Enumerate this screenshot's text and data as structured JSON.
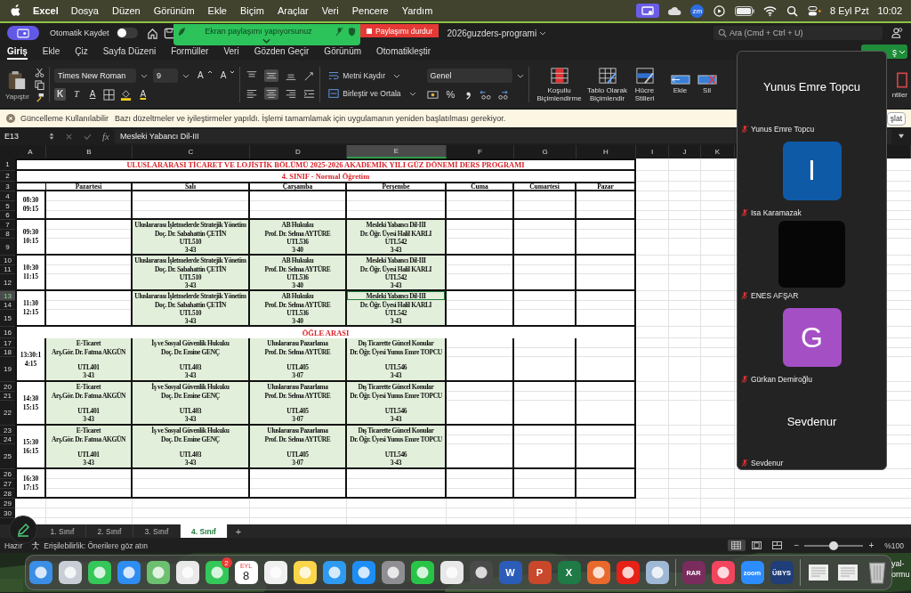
{
  "menu_bar": {
    "app": "Excel",
    "items": [
      "Dosya",
      "Düzen",
      "Görünüm",
      "Ekle",
      "Biçim",
      "Araçlar",
      "Veri",
      "Pencere",
      "Yardım"
    ],
    "zoom_badge": "zm",
    "date": "8 Eyl Pzt",
    "time": "10:02"
  },
  "title_bar": {
    "autosave_label": "Otomatik Kaydet",
    "autosave_on": false,
    "filename": "2026guzders-programi",
    "search_placeholder": "Ara (Cmd + Ctrl + U)"
  },
  "share_banner": {
    "text": "Ekran paylaşımı yapıyorsunuz",
    "stop_button": "Paylaşımı durdur"
  },
  "ribbon_tabs": [
    {
      "label": "Giriş",
      "selected": true
    },
    {
      "label": "Ekle",
      "selected": false
    },
    {
      "label": "Çiz",
      "selected": false
    },
    {
      "label": "Sayfa Düzeni",
      "selected": false
    },
    {
      "label": "Formüller",
      "selected": false
    },
    {
      "label": "Veri",
      "selected": false
    },
    {
      "label": "Gözden Geçir",
      "selected": false
    },
    {
      "label": "Görünüm",
      "selected": false
    },
    {
      "label": "Otomatikleştir",
      "selected": false
    }
  ],
  "share_button": "ş",
  "ribbon": {
    "paste": "Yapıştır",
    "font": "Times New Roman",
    "size": "9",
    "grow": "A",
    "shrink": "A",
    "styles": [
      {
        "label": "K",
        "kind": "bold",
        "selected": true
      },
      {
        "label": "T",
        "kind": "italic",
        "selected": false
      },
      {
        "label": "A",
        "kind": "underline",
        "selected": false
      }
    ],
    "font_color": "A",
    "align_vertical": [
      {
        "kind": "top",
        "selected": false
      },
      {
        "kind": "middle",
        "selected": true
      },
      {
        "kind": "bottom",
        "selected": false
      }
    ],
    "align_horizontal": [
      {
        "kind": "left",
        "selected": false
      },
      {
        "kind": "center",
        "selected": true
      },
      {
        "kind": "right",
        "selected": false
      }
    ],
    "wrap": "Metni Kaydır",
    "merge": "Birleştir ve Ortala",
    "number_format": "Genel",
    "percent": "%",
    "big_buttons": [
      {
        "label": "Koşullu Biçimlendirme",
        "kind": "conditional"
      },
      {
        "label": "Tablo Olarak Biçimlendir",
        "kind": "table"
      },
      {
        "label": "Hücre Stilleri",
        "kind": "styles"
      },
      {
        "label": "Ekle",
        "kind": "insert"
      },
      {
        "label": "Sil",
        "kind": "delete"
      }
    ],
    "cut_button": "ntiler"
  },
  "notification": {
    "title": "Güncelleme Kullanılabilir",
    "message": "Bazı düzeltmeler ve iyileştirmeler yapıldı. İşlemi tamamlamak için uygulamanın yeniden başlatılması gerekiyor.",
    "button": "şlat"
  },
  "formula_bar": {
    "cell": "E13",
    "fx": "fx",
    "value": "Mesleki Yabancı Dil-III"
  },
  "columns": [
    {
      "label": "A",
      "selected": false
    },
    {
      "label": "B",
      "selected": false
    },
    {
      "label": "C",
      "selected": false
    },
    {
      "label": "D",
      "selected": false
    },
    {
      "label": "E",
      "selected": true
    },
    {
      "label": "F",
      "selected": false
    },
    {
      "label": "G",
      "selected": false
    },
    {
      "label": "H",
      "selected": false
    },
    {
      "label": "I",
      "selected": false
    },
    {
      "label": "J",
      "selected": false
    },
    {
      "label": "K",
      "selected": false
    }
  ],
  "rows": [
    {
      "label": "1",
      "selected": false
    },
    {
      "label": "2",
      "selected": false
    },
    {
      "label": "3",
      "selected": false
    },
    {
      "label": "4",
      "selected": false
    },
    {
      "label": "5",
      "selected": false
    },
    {
      "label": "6",
      "selected": false
    },
    {
      "label": "7",
      "selected": false
    },
    {
      "label": "8",
      "selected": false
    },
    {
      "label": "9",
      "selected": false
    },
    {
      "label": "10",
      "selected": false
    },
    {
      "label": "11",
      "selected": false
    },
    {
      "label": "12",
      "selected": false
    },
    {
      "label": "13",
      "selected": true
    },
    {
      "label": "14",
      "selected": false
    },
    {
      "label": "15",
      "selected": false
    },
    {
      "label": "16",
      "selected": false
    },
    {
      "label": "17",
      "selected": false
    },
    {
      "label": "18",
      "selected": false
    },
    {
      "label": "19",
      "selected": false
    },
    {
      "label": "20",
      "selected": false
    },
    {
      "label": "21",
      "selected": false
    },
    {
      "label": "22",
      "selected": false
    },
    {
      "label": "23",
      "selected": false
    },
    {
      "label": "24",
      "selected": false
    },
    {
      "label": "25",
      "selected": false
    },
    {
      "label": "26",
      "selected": false
    },
    {
      "label": "27",
      "selected": false
    },
    {
      "label": "28",
      "selected": false
    },
    {
      "label": "29",
      "selected": false
    },
    {
      "label": "30",
      "selected": false
    }
  ],
  "schedule": {
    "title": "ULUSLARARASI TİCARET VE LOJİSTİK BÖLÜMÜ 2025-2026 AKADEMİK YILI GÜZ DÖNEMİ DERS PROGRAMI",
    "subtitle": "4. SINIF - Normal Öğretim",
    "days": [
      "Pazartesi",
      "Salı",
      "Çarşamba",
      "Perşembe",
      "Cuma",
      "Cumartesi",
      "Pazar"
    ],
    "slots": [
      {
        "kind": "slot",
        "time": [
          "08:30",
          "09:15"
        ],
        "cells": [
          {
            "kind": "empty",
            "selected": false
          },
          {
            "kind": "empty",
            "selected": false
          },
          {
            "kind": "empty",
            "selected": false
          },
          {
            "kind": "empty",
            "selected": false
          },
          {
            "kind": "empty",
            "selected": false
          },
          {
            "kind": "empty",
            "selected": false
          },
          {
            "kind": "empty",
            "selected": false
          }
        ]
      },
      {
        "kind": "slot",
        "time": [
          "09:30",
          "10:15"
        ],
        "cells": [
          {
            "kind": "empty",
            "selected": false
          },
          {
            "kind": "course",
            "name": "Uluslararası İşletmelerde Stratejik Yönetim",
            "teacher": "Doç. Dr. Sabahattin ÇETİN",
            "code": "UTL510",
            "room": "3-43",
            "selected": false
          },
          {
            "kind": "course",
            "name": "AB Hukuku",
            "teacher": "Prof. Dr. Selma AYTÜRE",
            "code": "UTL536",
            "room": "3-40",
            "selected": false
          },
          {
            "kind": "course",
            "name": "Mesleki Yabancı Dil-III",
            "teacher": "Dr. Öğr. Üyesi Halil KARLI",
            "code": "UTL542",
            "room": "3-43",
            "selected": false
          },
          {
            "kind": "empty",
            "selected": false
          },
          {
            "kind": "empty",
            "selected": false
          },
          {
            "kind": "empty",
            "selected": false
          }
        ]
      },
      {
        "kind": "slot",
        "time": [
          "10:30",
          "11:15"
        ],
        "cells": [
          {
            "kind": "empty",
            "selected": false
          },
          {
            "kind": "course",
            "name": "Uluslararası İşletmelerde Stratejik Yönetim",
            "teacher": "Doç. Dr. Sabahattin ÇETİN",
            "code": "UTL510",
            "room": "3-43",
            "selected": false
          },
          {
            "kind": "course",
            "name": "AB Hukuku",
            "teacher": "Prof. Dr. Selma AYTÜRE",
            "code": "UTL536",
            "room": "3-40",
            "selected": false
          },
          {
            "kind": "course",
            "name": "Mesleki Yabancı Dil-III",
            "teacher": "Dr. Öğr. Üyesi Halil KARLI",
            "code": "UTL542",
            "room": "3-43",
            "selected": false
          },
          {
            "kind": "empty",
            "selected": false
          },
          {
            "kind": "empty",
            "selected": false
          },
          {
            "kind": "empty",
            "selected": false
          }
        ]
      },
      {
        "kind": "slot",
        "time": [
          "11:30",
          "12:15"
        ],
        "cells": [
          {
            "kind": "empty",
            "selected": false
          },
          {
            "kind": "course",
            "name": "Uluslararası İşletmelerde Stratejik Yönetim",
            "teacher": "Doç. Dr. Sabahattin ÇETİN",
            "code": "UTL510",
            "room": "3-43",
            "selected": false
          },
          {
            "kind": "course",
            "name": "AB Hukuku",
            "teacher": "Prof. Dr. Selma AYTÜRE",
            "code": "UTL536",
            "room": "3-40",
            "selected": false
          },
          {
            "kind": "course",
            "name": "Mesleki Yabancı Dil-III",
            "teacher": "Dr. Öğr. Üyesi Halil KARLI",
            "code": "UTL542",
            "room": "3-43",
            "selected": true
          },
          {
            "kind": "empty",
            "selected": false
          },
          {
            "kind": "empty",
            "selected": false
          },
          {
            "kind": "empty",
            "selected": false
          }
        ]
      },
      {
        "kind": "break",
        "label": "ÖĞLE ARASI"
      },
      {
        "kind": "slot",
        "time": [
          "13:30:14:15"
        ],
        "cells": [
          {
            "kind": "course",
            "name": "E-Ticaret",
            "teacher": "Arş.Gör. Dr. Fatma AKGÜN",
            "code": "UTL401",
            "room": "3-43",
            "selected": false
          },
          {
            "kind": "course",
            "name": "İş ve Sosyal Güvenlik Hukuku",
            "teacher": "Doç. Dr. Emine GENÇ",
            "code": "UTL403",
            "room": "3-43",
            "selected": false
          },
          {
            "kind": "course",
            "name": "Uluslararası Pazarlama",
            "teacher": "Prof. Dr. Selma AYTÜRE",
            "code": "UTL405",
            "room": "3-07",
            "selected": false
          },
          {
            "kind": "course",
            "name": "Dış Ticarette Güncel Konular",
            "teacher": "Dr. Öğr. Üyesi Yunus Emre TOPCU",
            "code": "UTL546",
            "room": "3-43",
            "selected": false
          },
          {
            "kind": "empty",
            "selected": false
          },
          {
            "kind": "empty",
            "selected": false
          },
          {
            "kind": "empty",
            "selected": false
          }
        ]
      },
      {
        "kind": "slot",
        "time": [
          "14:30",
          "15:15"
        ],
        "cells": [
          {
            "kind": "course",
            "name": "E-Ticaret",
            "teacher": "Arş.Gör. Dr. Fatma AKGÜN",
            "code": "UTL401",
            "room": "3-43",
            "selected": false
          },
          {
            "kind": "course",
            "name": "İş ve Sosyal Güvenlik Hukuku",
            "teacher": "Doç. Dr. Emine GENÇ",
            "code": "UTL403",
            "room": "3-43",
            "selected": false
          },
          {
            "kind": "course",
            "name": "Uluslararası Pazarlama",
            "teacher": "Prof. Dr. Selma AYTÜRE",
            "code": "UTL405",
            "room": "3-07",
            "selected": false
          },
          {
            "kind": "course",
            "name": "Dış Ticarette Güncel Konular",
            "teacher": "Dr. Öğr. Üyesi Yunus Emre TOPCU",
            "code": "UTL546",
            "room": "3-43",
            "selected": false
          },
          {
            "kind": "empty",
            "selected": false
          },
          {
            "kind": "empty",
            "selected": false
          },
          {
            "kind": "empty",
            "selected": false
          }
        ]
      },
      {
        "kind": "slot",
        "time": [
          "15:30",
          "16:15"
        ],
        "cells": [
          {
            "kind": "course",
            "name": "E-Ticaret",
            "teacher": "Arş.Gör. Dr. Fatma AKGÜN",
            "code": "UTL401",
            "room": "3-43",
            "selected": false
          },
          {
            "kind": "course",
            "name": "İş ve Sosyal Güvenlik Hukuku",
            "teacher": "Doç. Dr. Emine GENÇ",
            "code": "UTL403",
            "room": "3-43",
            "selected": false
          },
          {
            "kind": "course",
            "name": "Uluslararası Pazarlama",
            "teacher": "Prof. Dr. Selma AYTÜRE",
            "code": "UTL405",
            "room": "3-07",
            "selected": false
          },
          {
            "kind": "course",
            "name": "Dış Ticarette Güncel Konular",
            "teacher": "Dr. Öğr. Üyesi Yunus Emre TOPCU",
            "code": "UTL546",
            "room": "3-43",
            "selected": false
          },
          {
            "kind": "empty",
            "selected": false
          },
          {
            "kind": "empty",
            "selected": false
          },
          {
            "kind": "empty",
            "selected": false
          }
        ]
      },
      {
        "kind": "slot",
        "time": [
          "16:30",
          "17:15"
        ],
        "cells": [
          {
            "kind": "empty",
            "selected": false
          },
          {
            "kind": "empty",
            "selected": false
          },
          {
            "kind": "empty",
            "selected": false
          },
          {
            "kind": "empty",
            "selected": false
          },
          {
            "kind": "empty",
            "selected": false
          },
          {
            "kind": "empty",
            "selected": false
          },
          {
            "kind": "empty",
            "selected": false
          }
        ]
      }
    ]
  },
  "sheet_tabs": {
    "tabs": [
      {
        "label": "1. Sınıf",
        "selected": false
      },
      {
        "label": "2. Sınıf",
        "selected": false
      },
      {
        "label": "3. Sınıf",
        "selected": false
      },
      {
        "label": "4. Sınıf",
        "selected": true
      }
    ],
    "add": "+"
  },
  "status_bar": {
    "ready": "Hazır",
    "accessibility": "Erişilebilirlik: Önerilere göz atın",
    "views": [
      {
        "kind": "normal",
        "selected": true
      },
      {
        "kind": "page_layout",
        "selected": false
      },
      {
        "kind": "page_break",
        "selected": false
      }
    ],
    "zoom": {
      "minus": "−",
      "plus": "+",
      "level": 0.5,
      "label": "%100"
    }
  },
  "video_panel": {
    "tiles": [
      {
        "kind": "name",
        "title": "Yunus Emre Topcu",
        "label": "Yunus Emre Topcu",
        "muted": true
      },
      {
        "kind": "avatar",
        "initial": "I",
        "color": "#0e5aa7",
        "label": "Isa Karamazak",
        "muted": true
      },
      {
        "kind": "video",
        "label": "ENES AFŞAR",
        "muted": true
      },
      {
        "kind": "avatar",
        "initial": "G",
        "color": "#a54fc5",
        "label": "Gürkan Demiroğlu",
        "muted": true
      },
      {
        "kind": "name",
        "title": "Sevdenur",
        "label": "Sevdenur",
        "muted": true
      }
    ]
  },
  "dock": [
    {
      "kind": "finder"
    },
    {
      "kind": "launchpad"
    },
    {
      "kind": "messages"
    },
    {
      "kind": "mail"
    },
    {
      "kind": "maps"
    },
    {
      "kind": "photos"
    },
    {
      "kind": "facetime",
      "badge": "2"
    },
    {
      "kind": "calendar",
      "month": "EYL",
      "day": "8"
    },
    {
      "kind": "reminders"
    },
    {
      "kind": "notes"
    },
    {
      "kind": "safari"
    },
    {
      "kind": "appstore"
    },
    {
      "kind": "settings"
    },
    {
      "kind": "whatsapp"
    },
    {
      "kind": "chrome"
    },
    {
      "kind": "calculator"
    },
    {
      "kind": "word",
      "label": "W"
    },
    {
      "kind": "powerpoint",
      "label": "P"
    },
    {
      "kind": "excel",
      "label": "X"
    },
    {
      "kind": "firefox"
    },
    {
      "kind": "youtube"
    },
    {
      "kind": "iphone"
    },
    {
      "kind": "separator"
    },
    {
      "kind": "rar",
      "label": "RAR"
    },
    {
      "kind": "music"
    },
    {
      "kind": "zoom",
      "label": "zoom"
    },
    {
      "kind": "ubys",
      "label": "ÜBYS"
    },
    {
      "kind": "separator"
    },
    {
      "kind": "document"
    },
    {
      "kind": "document"
    },
    {
      "kind": "trash"
    }
  ],
  "desktop_labels": [
    "yal-",
    "ormu"
  ]
}
